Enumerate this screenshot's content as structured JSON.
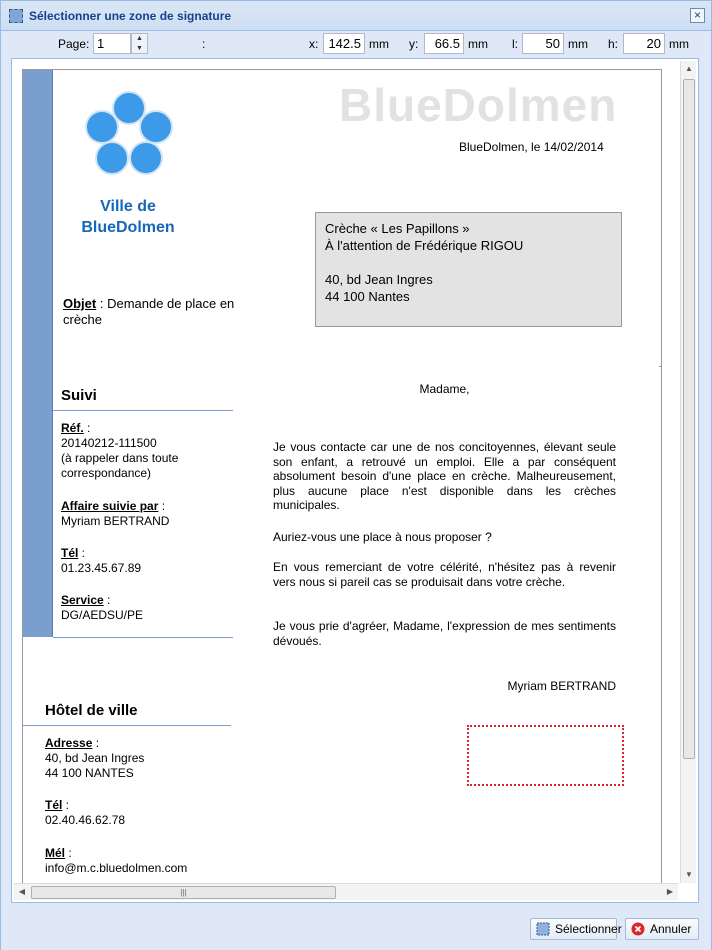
{
  "window": {
    "title": "Sélectionner une zone de signature",
    "close_icon": "close-icon"
  },
  "toolbar": {
    "page_label": "Page:",
    "page_value": "1",
    "separator": ":",
    "x_label": "x:",
    "x_value": "142.5",
    "x_unit": "mm",
    "y_label": "y:",
    "y_value": "66.5",
    "y_unit": "mm",
    "l_label": "l:",
    "l_value": "50",
    "l_unit": "mm",
    "h_label": "h:",
    "h_value": "20",
    "h_unit": "mm"
  },
  "document": {
    "brand": "BlueDolmen",
    "city_line1": "Ville de",
    "city_line2": "BlueDolmen",
    "dateline": "BlueDolmen, le  14/02/2014",
    "recipient": [
      "Crèche « Les Papillons »",
      "À l'attention de Frédérique RIGOU",
      "",
      "40, bd Jean Ingres",
      "44 100 Nantes"
    ],
    "objet_label": "Objet",
    "objet_sep": " : ",
    "objet_text": "Demande de place en crèche",
    "suivi_title": "Suivi",
    "ref_label": "Réf.",
    "ref_value": "20140212-111500",
    "ref_note": "(à rappeler dans toute correspondance)",
    "affaire_label": "Affaire suivie par",
    "affaire_value": "Myriam BERTRAND",
    "tel_label": "Tél",
    "tel_value": "01.23.45.67.89",
    "service_label": "Service",
    "service_value": "DG/AEDSU/PE",
    "colon": " :",
    "hotel_title": "Hôtel de ville",
    "adresse_label": "Adresse",
    "adresse_value1": "40, bd Jean Ingres",
    "adresse_value2": "44 100 NANTES",
    "hotel_tel_label": "Tél",
    "hotel_tel_value": "02.40.46.62.78",
    "mel_label": "Mél",
    "mel_value": "info@m.c.bluedolmen.com",
    "salutation": "Madame,",
    "para1": "Je vous contacte car une de nos concitoyennes, élevant seule son enfant, a retrouvé un emploi. Elle a par conséquent absolument besoin d'une place en crèche. Malheureusement, plus aucune place n'est disponible dans les crèches municipales.",
    "para2": "Auriez-vous une place à nous proposer ?",
    "para3": "En vous remerciant de votre célérité, n'hésitez pas à revenir vers nous si pareil cas se produisait dans votre crèche.",
    "para4": "Je vous prie d'agréer, Madame, l'expression de mes sentiments dévoués.",
    "signature": "Myriam BERTRAND"
  },
  "buttons": {
    "select_label": "Sélectionner",
    "cancel_label": "Annuler"
  },
  "colors": {
    "accent": "#7a9fcf",
    "title_blue": "#1667b8",
    "signature_zone": "#d9252b"
  }
}
